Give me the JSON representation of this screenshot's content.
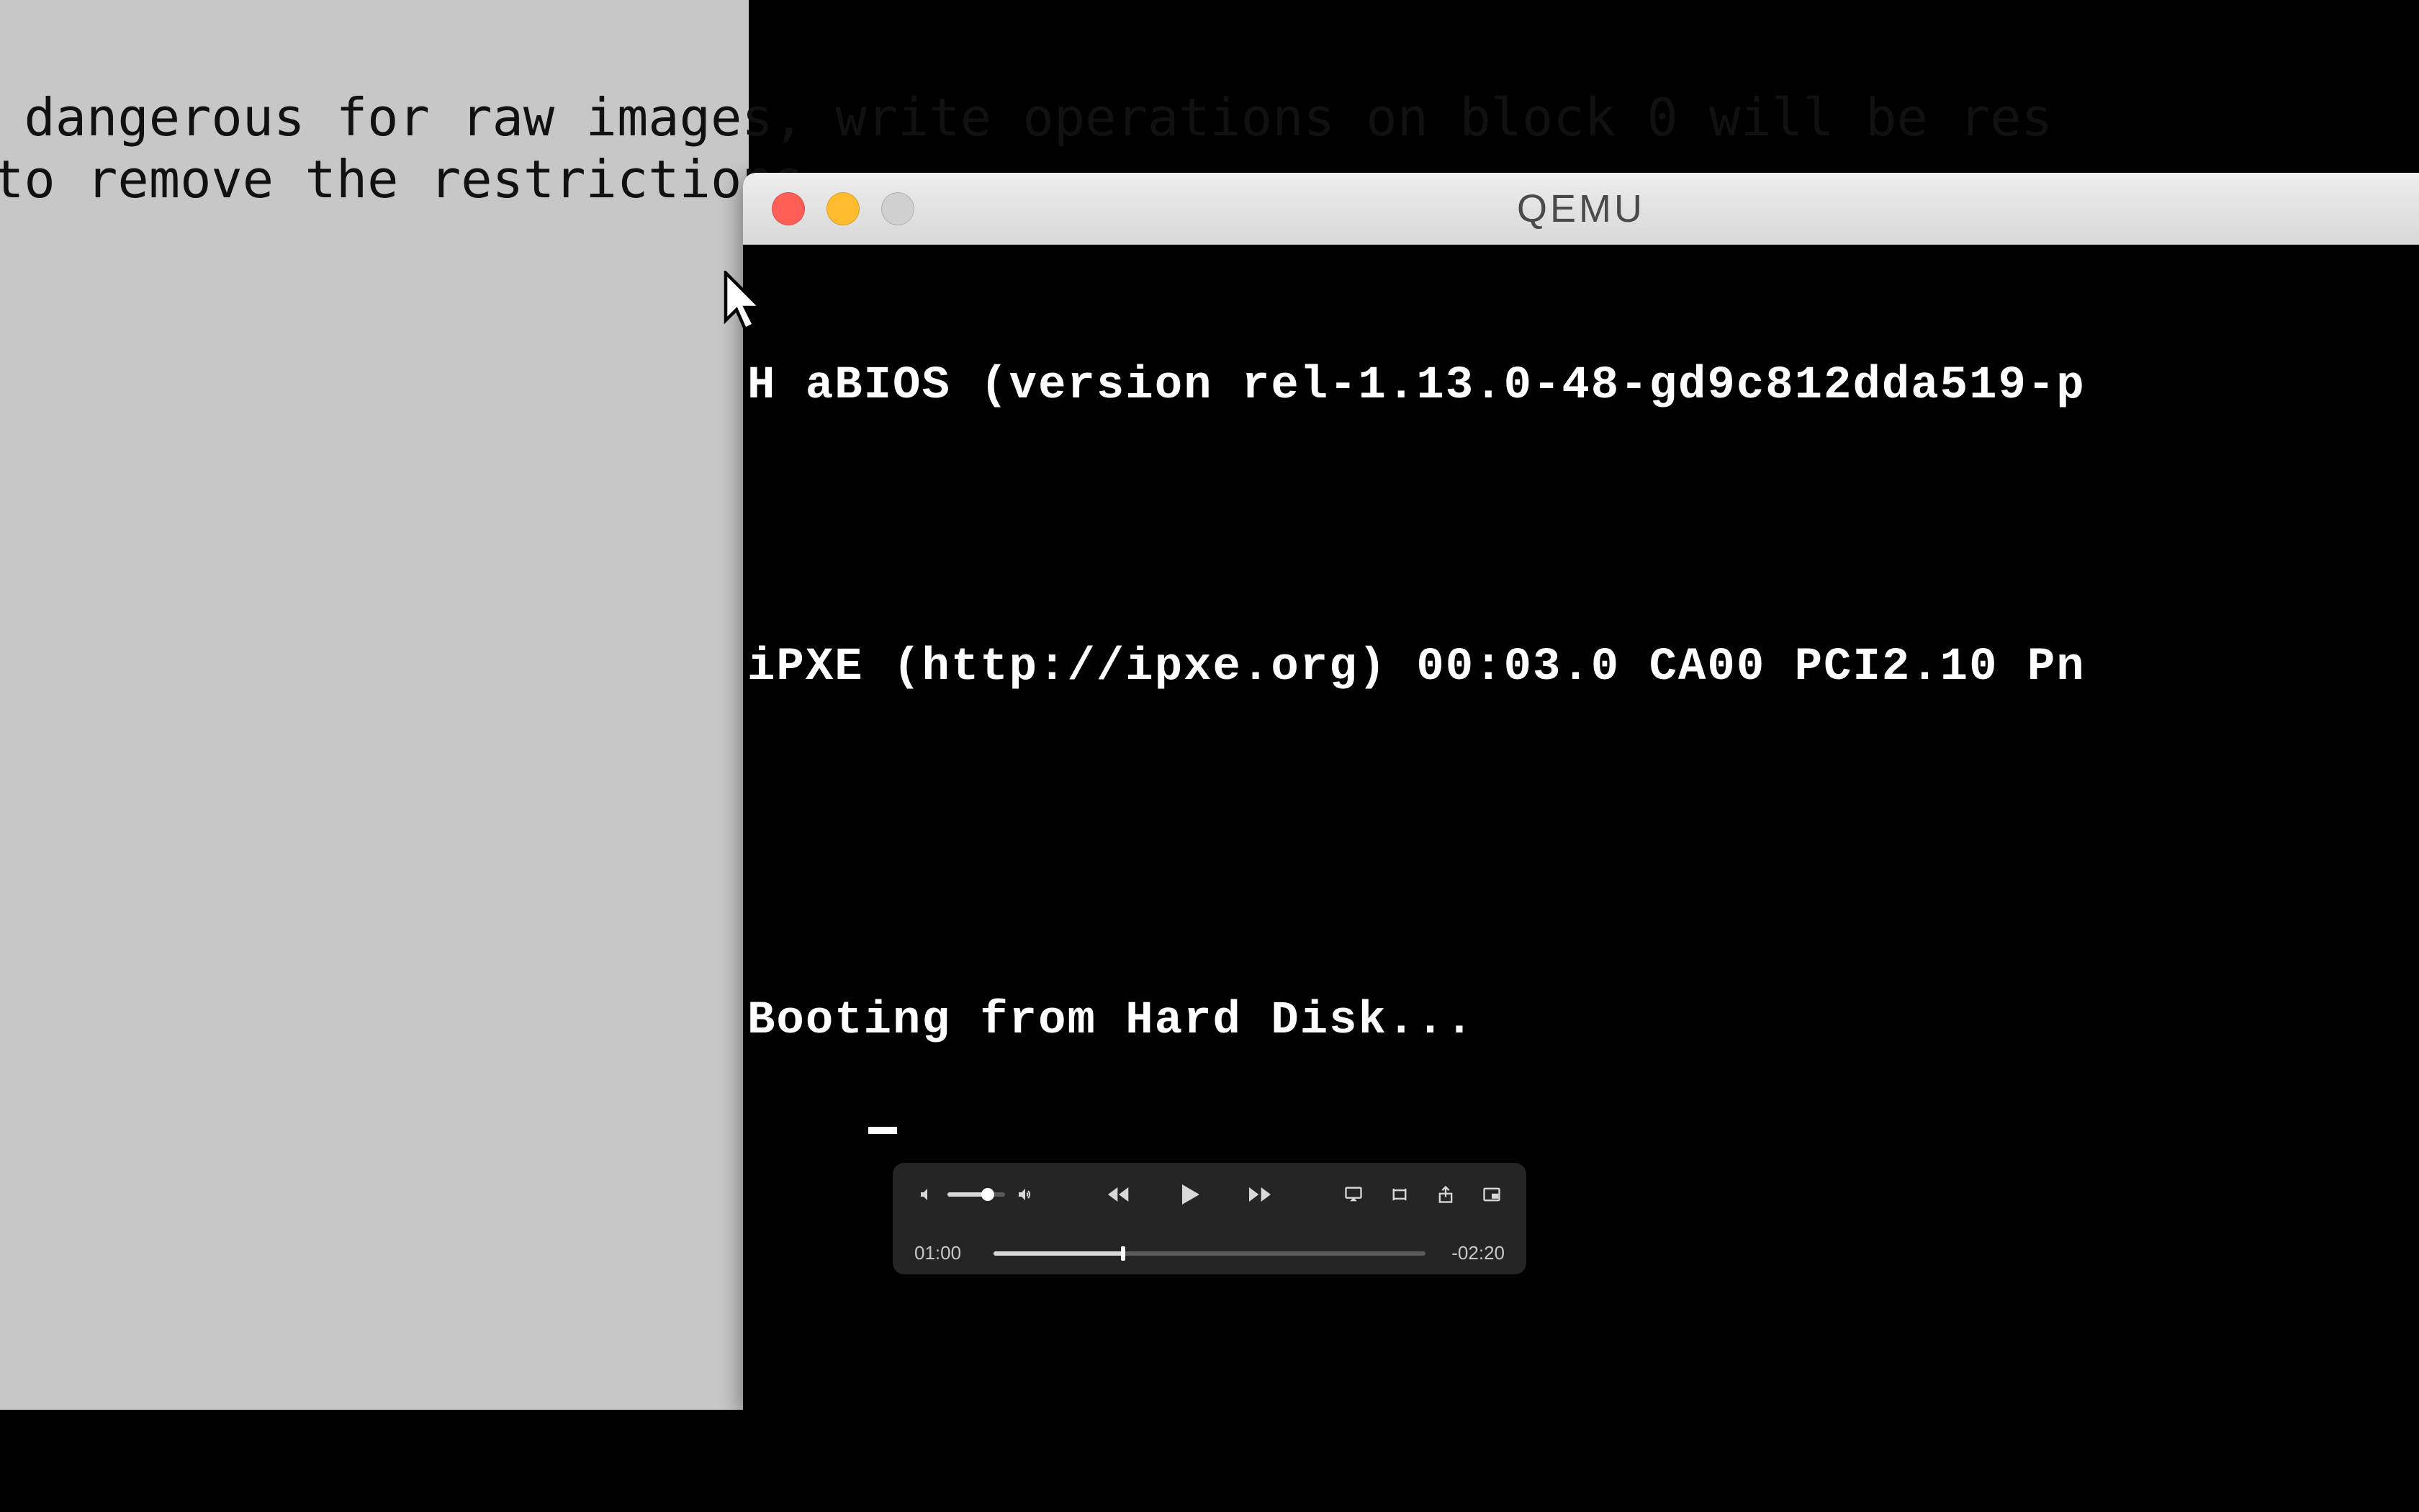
{
  "background_terminal": {
    "line1": " dangerous for raw images, write operations on block 0 will be res",
    "line2": "to remove the restrictions"
  },
  "qemu_window": {
    "title": "QEMU",
    "traffic_lights": {
      "close": "close",
      "minimize": "minimize",
      "zoom": "zoom"
    },
    "lines": {
      "bios": "H aBIOS (version rel-1.13.0-48-gd9c812dda519-p",
      "ipxe": "iPXE (http://ipxe.org) 00:03.0 CA00 PCI2.10 Pn",
      "boot": "Booting from Hard Disk..."
    }
  },
  "player": {
    "elapsed": "01:00",
    "remaining": "-02:20",
    "progress_fraction": 0.3,
    "volume_fraction": 0.7,
    "icons": {
      "mute": "mute-icon",
      "volume_up": "volume-up-icon",
      "rewind": "rewind-icon",
      "play": "play-icon",
      "fast_forward": "fast-forward-icon",
      "airplay": "airplay-icon",
      "trim": "trim-icon",
      "share": "share-icon",
      "pip": "picture-in-picture-icon"
    }
  }
}
